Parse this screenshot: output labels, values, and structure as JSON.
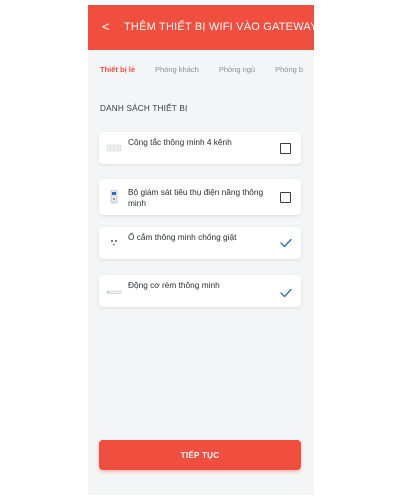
{
  "header": {
    "back_icon": "chevron-left-icon",
    "title": "THÊM THIẾT BỊ WIFI VÀO GATEWAY",
    "color": "#f04f3f"
  },
  "tabs": [
    {
      "label": "Thiết bị lẻ",
      "active": true
    },
    {
      "label": "Phòng khách",
      "active": false
    },
    {
      "label": "Phòng ngủ",
      "active": false
    },
    {
      "label": "Phòng b",
      "active": false
    }
  ],
  "section": {
    "title": "DANH SÁCH THIẾT BỊ"
  },
  "devices": [
    {
      "name": "Công tắc thông minh 4 kênh",
      "selected": false,
      "icon": "wall-switch-icon"
    },
    {
      "name": "Bộ giám sát tiêu thụ điện năng thông minh",
      "selected": false,
      "icon": "power-meter-icon"
    },
    {
      "name": "Ổ cắm thông minh chống giật",
      "selected": true,
      "icon": "smart-socket-icon"
    },
    {
      "name": "Động cơ rèm thông minh",
      "selected": true,
      "icon": "curtain-motor-icon"
    }
  ],
  "continue_button": {
    "label": "TIẾP TỤC"
  }
}
